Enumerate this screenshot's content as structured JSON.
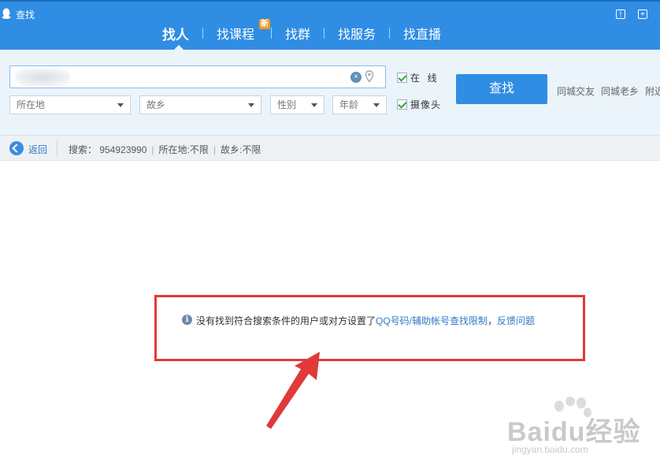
{
  "window": {
    "title": "查找"
  },
  "tabs": [
    {
      "label": "找人",
      "active": true
    },
    {
      "label": "找课程",
      "badge": "新"
    },
    {
      "label": "找群"
    },
    {
      "label": "找服务"
    },
    {
      "label": "找直播"
    }
  ],
  "search": {
    "input_value": "",
    "filters": {
      "location": "所在地",
      "hometown": "故乡",
      "gender": "性别",
      "age": "年龄"
    },
    "options": {
      "online_label": "在  线",
      "online_checked": true,
      "camera_label": "摄像头",
      "camera_checked": true
    },
    "find_button": "查找",
    "quick_links": [
      "同城交友",
      "同城老乡",
      "附近"
    ]
  },
  "breadcrumb": {
    "back_label": "返回",
    "query": "搜索： 954923990",
    "location": "所在地:不限",
    "hometown": "故乡:不限"
  },
  "result": {
    "message": "没有找到符合搜索条件的用户或对方设置了",
    "link_restriction": "QQ号码/辅助帐号查找限制",
    "separator": "，",
    "link_feedback": "反馈问题"
  },
  "watermark": {
    "main": "Baidu经验",
    "sub": "jingyan.baidu.com"
  },
  "colors": {
    "header_blue": "#2f8de4",
    "panel_bg": "#ebf3fb",
    "link_blue": "#2f7ac7",
    "annotation_red": "#e03a3a",
    "check_green": "#2ea82e"
  }
}
